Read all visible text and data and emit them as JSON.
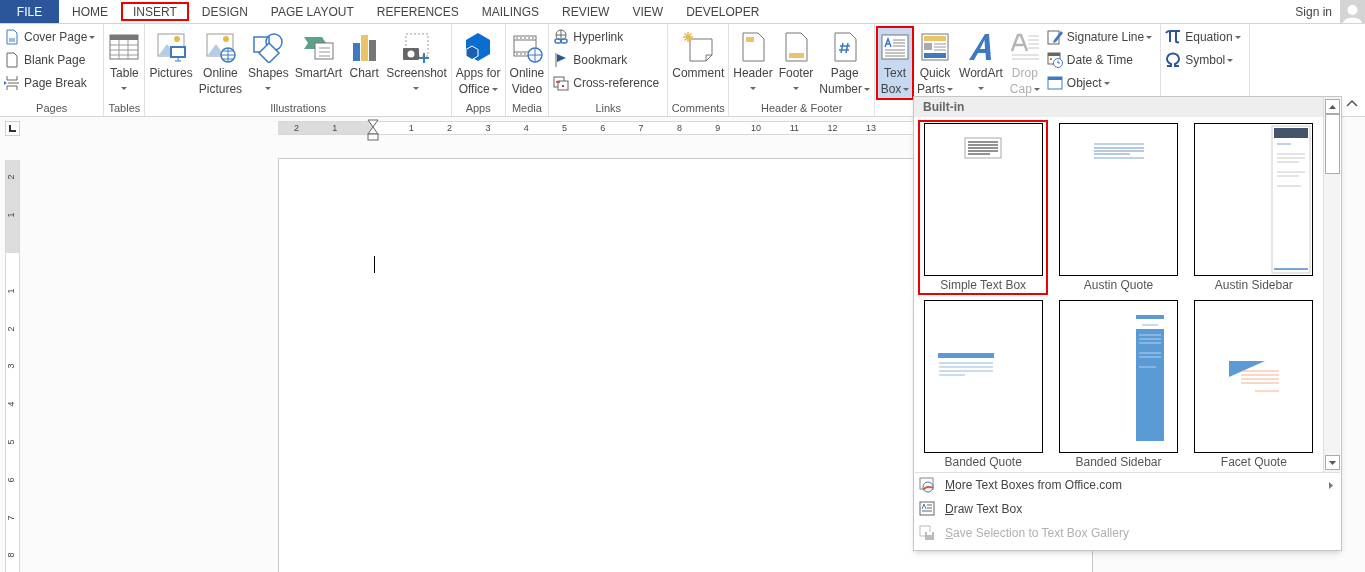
{
  "tabs": [
    {
      "label": "FILE",
      "kind": "file",
      "selected": false
    },
    {
      "label": "HOME",
      "kind": "tab",
      "selected": false
    },
    {
      "label": "INSERT",
      "kind": "tab",
      "selected": true
    },
    {
      "label": "DESIGN",
      "kind": "tab",
      "selected": false
    },
    {
      "label": "PAGE LAYOUT",
      "kind": "tab",
      "selected": false
    },
    {
      "label": "REFERENCES",
      "kind": "tab",
      "selected": false
    },
    {
      "label": "MAILINGS",
      "kind": "tab",
      "selected": false
    },
    {
      "label": "REVIEW",
      "kind": "tab",
      "selected": false
    },
    {
      "label": "VIEW",
      "kind": "tab",
      "selected": false
    },
    {
      "label": "DEVELOPER",
      "kind": "tab",
      "selected": false
    }
  ],
  "account": {
    "label": "Sign in"
  },
  "ribbon_groups": [
    {
      "label": "Pages",
      "items": [
        {
          "kind": "stack",
          "items": [
            {
              "label": "Cover Page",
              "dropdown": true,
              "disabled": false
            },
            {
              "label": "Blank Page",
              "dropdown": false,
              "disabled": false
            },
            {
              "label": "Page Break",
              "dropdown": false,
              "disabled": false
            }
          ]
        }
      ]
    },
    {
      "label": "Tables",
      "items": [
        {
          "kind": "large",
          "label": "Table",
          "dropdown": true,
          "disabled": false,
          "open": false
        }
      ]
    },
    {
      "label": "Illustrations",
      "items": [
        {
          "kind": "large",
          "label": "Pictures",
          "dropdown": false,
          "disabled": false,
          "open": false
        },
        {
          "kind": "large",
          "label": "Online\nPictures",
          "dropdown": false,
          "disabled": false,
          "open": false
        },
        {
          "kind": "large",
          "label": "Shapes",
          "dropdown": true,
          "disabled": false,
          "open": false
        },
        {
          "kind": "large",
          "label": "SmartArt",
          "dropdown": false,
          "disabled": false,
          "open": false
        },
        {
          "kind": "large",
          "label": "Chart",
          "dropdown": false,
          "disabled": false,
          "open": false
        },
        {
          "kind": "large",
          "label": "Screenshot",
          "dropdown": true,
          "disabled": false,
          "open": false
        }
      ]
    },
    {
      "label": "Apps",
      "items": [
        {
          "kind": "large",
          "label": "Apps for\nOffice",
          "dropdown": true,
          "disabled": false,
          "open": false
        }
      ]
    },
    {
      "label": "Media",
      "items": [
        {
          "kind": "large",
          "label": "Online\nVideo",
          "dropdown": false,
          "disabled": false,
          "open": false
        }
      ]
    },
    {
      "label": "Links",
      "items": [
        {
          "kind": "stack",
          "items": [
            {
              "label": "Hyperlink",
              "dropdown": false,
              "disabled": false
            },
            {
              "label": "Bookmark",
              "dropdown": false,
              "disabled": false
            },
            {
              "label": "Cross-reference",
              "dropdown": false,
              "disabled": false
            }
          ]
        }
      ]
    },
    {
      "label": "Comments",
      "items": [
        {
          "kind": "large",
          "label": "Comment",
          "dropdown": false,
          "disabled": false,
          "open": false
        }
      ]
    },
    {
      "label": "Header & Footer",
      "items": [
        {
          "kind": "large",
          "label": "Header",
          "dropdown": true,
          "disabled": false,
          "open": false
        },
        {
          "kind": "large",
          "label": "Footer",
          "dropdown": true,
          "disabled": false,
          "open": false
        },
        {
          "kind": "large",
          "label": "Page\nNumber",
          "dropdown": true,
          "disabled": false,
          "open": false
        }
      ]
    },
    {
      "items": [
        {
          "kind": "large",
          "label": "Text\nBox",
          "dropdown": true,
          "disabled": false,
          "open": true
        },
        {
          "kind": "large",
          "label": "Quick\nParts",
          "dropdown": true,
          "disabled": false,
          "open": false
        },
        {
          "kind": "large",
          "label": "WordArt",
          "dropdown": true,
          "disabled": false,
          "open": false
        },
        {
          "kind": "large",
          "label": "Drop\nCap",
          "dropdown": true,
          "disabled": true,
          "open": false
        },
        {
          "kind": "stack",
          "items": [
            {
              "label": "Signature Line",
              "dropdown": true,
              "disabled": false
            },
            {
              "label": "Date & Time",
              "dropdown": false,
              "disabled": false
            },
            {
              "label": "Object",
              "dropdown": true,
              "disabled": false
            }
          ]
        }
      ]
    },
    {
      "items": [
        {
          "kind": "stack",
          "items": [
            {
              "label": "Equation",
              "dropdown": true,
              "disabled": false
            },
            {
              "label": "Symbol",
              "dropdown": true,
              "disabled": false
            }
          ]
        }
      ]
    }
  ],
  "ruler": {
    "horizontal": [
      "2",
      "1",
      "1",
      "2",
      "3",
      "4",
      "5",
      "6",
      "7",
      "8",
      "9",
      "10",
      "11",
      "12",
      "13"
    ],
    "vertical": [
      "2",
      "1",
      "1",
      "2",
      "3",
      "4",
      "5",
      "6",
      "7",
      "8"
    ]
  },
  "text_box_menu": {
    "section": "Built-in",
    "gallery": [
      {
        "label": "Simple Text Box",
        "selected": true
      },
      {
        "label": "Austin Quote",
        "selected": false
      },
      {
        "label": "Austin Sidebar",
        "selected": false
      },
      {
        "label": "Banded Quote",
        "selected": false
      },
      {
        "label": "Banded Sidebar",
        "selected": false
      },
      {
        "label": "Facet Quote",
        "selected": false
      }
    ],
    "commands": [
      {
        "label": "More Text Boxes from Office.com",
        "disabled": false,
        "submenu": true
      },
      {
        "label": "Draw Text Box",
        "disabled": false,
        "submenu": false
      },
      {
        "label": "Save Selection to Text Box Gallery",
        "disabled": true,
        "submenu": false
      }
    ]
  }
}
